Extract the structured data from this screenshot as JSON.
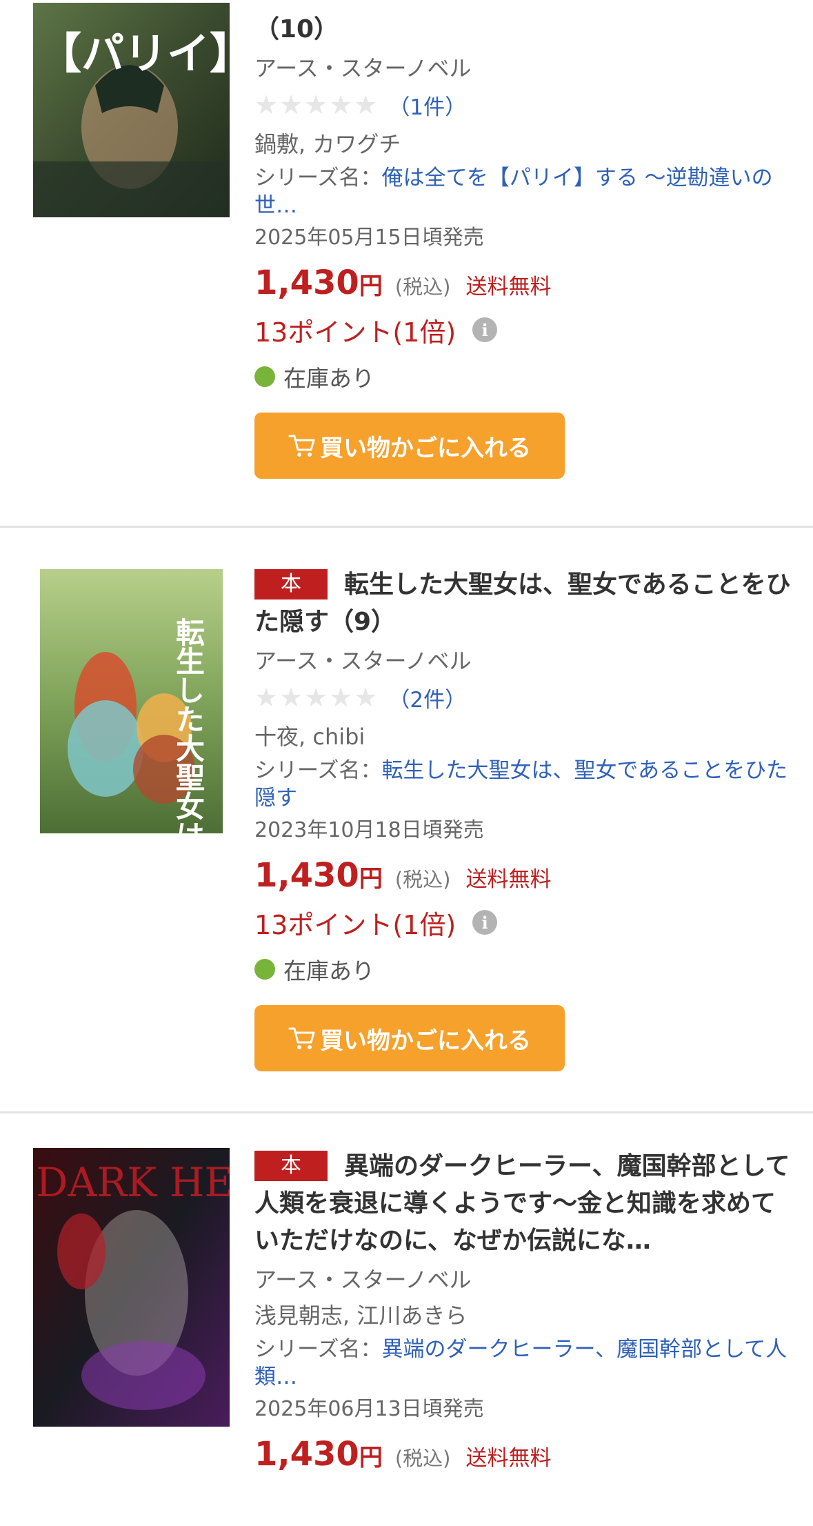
{
  "items": [
    {
      "badge": "",
      "title": "（10）",
      "publisher": "アース・スターノベル",
      "stars": "★★★★★",
      "review_count": "（1件）",
      "authors": "鍋敷, カワグチ",
      "series_label": "シリーズ名：",
      "series_name": "俺は全てを【パリイ】する 〜逆勘違いの世…",
      "release": "2025年05月15日頃発売",
      "price": "1,430",
      "yen": "円",
      "tax": "(税込)",
      "shipping": "送料無料",
      "points": "13ポイント(1倍)",
      "stock": "在庫あり",
      "cart_label": "買い物かごに入れる",
      "cover_text": "【パリイ】する"
    },
    {
      "badge": "本",
      "title": "転生した大聖女は、聖女であることをひた隠す（9）",
      "publisher": "アース・スターノベル",
      "stars": "★★★★★",
      "review_count": "（2件）",
      "authors": "十夜, chibi",
      "series_label": "シリーズ名：",
      "series_name": "転生した大聖女は、聖女であることをひた隠す",
      "release": "2023年10月18日頃発売",
      "price": "1,430",
      "yen": "円",
      "tax": "(税込)",
      "shipping": "送料無料",
      "points": "13ポイント(1倍)",
      "stock": "在庫あり",
      "cart_label": "買い物かごに入れる",
      "cover_text": "転生した大聖女は、"
    },
    {
      "badge": "本",
      "title": "異端のダークヒーラー、魔国幹部として人類を衰退に導くようです〜金と知識を求めていただけなのに、なぜか伝説にな…",
      "publisher": "アース・スターノベル",
      "authors": "浅見朝志, 江川あきら",
      "series_label": "シリーズ名：",
      "series_name": "異端のダークヒーラー、魔国幹部として人類…",
      "release": "2025年06月13日頃発売",
      "price": "1,430",
      "yen": "円",
      "tax": "(税込)",
      "shipping": "送料無料",
      "cover_text": "DARK HEALER"
    }
  ],
  "colors": {
    "price_red": "#bf1f1f",
    "link_blue": "#2f61b9",
    "cart_orange": "#f6a12b",
    "stock_green": "#78b33a"
  },
  "icons": {
    "cart": "cart-icon",
    "info": "info-icon",
    "stock": "stock-dot"
  }
}
